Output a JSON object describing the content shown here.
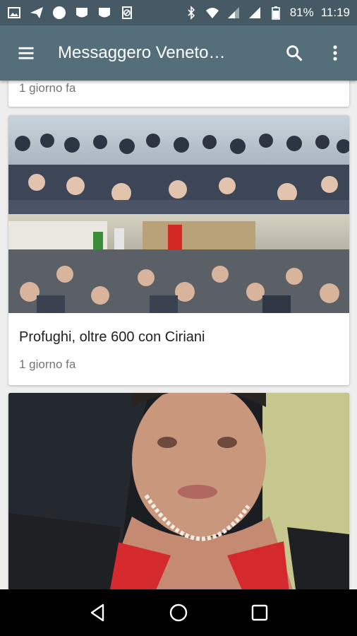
{
  "status_bar": {
    "battery": "81%",
    "time": "11:19",
    "left_icons": [
      "image-icon",
      "send-icon",
      "circle-icon",
      "shield-icon",
      "shield-icon",
      "no-sim-icon"
    ],
    "right_icons": [
      "bluetooth-icon",
      "wifi-icon",
      "signal-icon",
      "signal-icon",
      "battery-icon"
    ]
  },
  "app_bar": {
    "title": "Messaggero Veneto…",
    "background": "#546e7a",
    "status_background": "#455a64"
  },
  "feed": {
    "cards": [
      {
        "meta": "1 giorno fa"
      },
      {
        "title": "Profughi, oltre 600 con Ciriani",
        "meta": "1 giorno fa",
        "image": "crowd-photo"
      },
      {
        "image": "woman-portrait-photo"
      }
    ]
  },
  "nav_bar": {
    "buttons": [
      "back-icon",
      "home-icon",
      "recents-icon"
    ]
  }
}
